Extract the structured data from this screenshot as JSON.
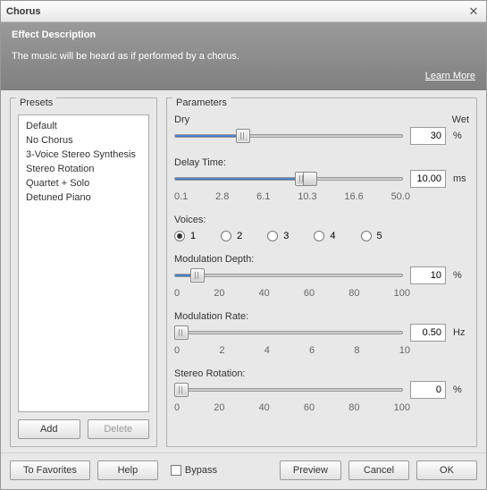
{
  "title": "Chorus",
  "description": {
    "heading": "Effect Description",
    "text": "The music will be heard as if performed by a chorus.",
    "learn_more": "Learn More"
  },
  "presets": {
    "title": "Presets",
    "items": [
      "Default",
      "No Chorus",
      "3-Voice Stereo Synthesis",
      "Stereo Rotation",
      "Quartet + Solo",
      "Detuned Piano"
    ],
    "add": "Add",
    "delete": "Delete"
  },
  "parameters": {
    "title": "Parameters",
    "dry_wet": {
      "left": "Dry",
      "right": "Wet",
      "value": "30",
      "unit": "%"
    },
    "delay": {
      "label": "Delay Time:",
      "value": "10.00",
      "unit": "ms",
      "ticks": [
        "0.1",
        "2.8",
        "6.1",
        "10.3",
        "16.6",
        "50.0"
      ]
    },
    "voices": {
      "label": "Voices:",
      "options": [
        "1",
        "2",
        "3",
        "4",
        "5"
      ],
      "selected": "1"
    },
    "mod_depth": {
      "label": "Modulation Depth:",
      "value": "10",
      "unit": "%",
      "ticks": [
        "0",
        "20",
        "40",
        "60",
        "80",
        "100"
      ]
    },
    "mod_rate": {
      "label": "Modulation Rate:",
      "value": "0.50",
      "unit": "Hz",
      "ticks": [
        "0",
        "2",
        "4",
        "6",
        "8",
        "10"
      ]
    },
    "stereo": {
      "label": "Stereo Rotation:",
      "value": "0",
      "unit": "%",
      "ticks": [
        "0",
        "20",
        "40",
        "60",
        "80",
        "100"
      ]
    }
  },
  "footer": {
    "to_favorites": "To Favorites",
    "help": "Help",
    "bypass": "Bypass",
    "preview": "Preview",
    "cancel": "Cancel",
    "ok": "OK"
  }
}
